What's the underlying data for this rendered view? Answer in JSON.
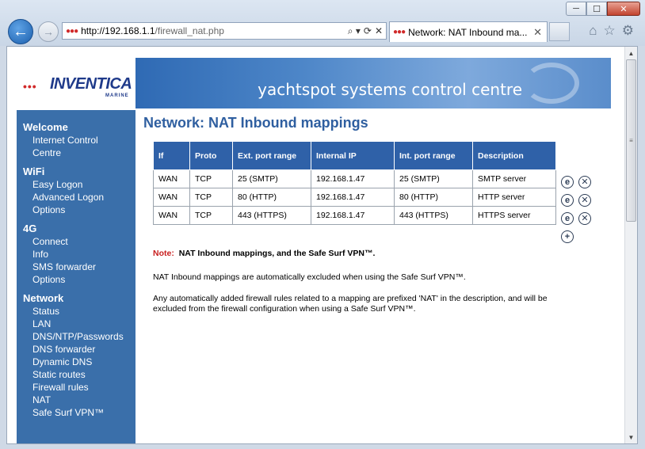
{
  "browser": {
    "url_host": "http://192.168.1.1",
    "url_path": "/firewall_nat.php",
    "tab_title": "Network: NAT Inbound ma...",
    "win_min": "─",
    "win_max": "☐",
    "win_close": "✕",
    "back_glyph": "←",
    "fwd_glyph": "→",
    "addr_icons": [
      "⌕ ▾",
      "⟳",
      "✕"
    ],
    "tab_close": "✕",
    "tool_icons": [
      "⌂",
      "☆",
      "⚙"
    ]
  },
  "header": {
    "logo_word": "INVENTICA",
    "logo_sub": "MARINE",
    "banner_text": "yachtspot systems control centre"
  },
  "sidebar": {
    "sections": [
      {
        "title": "Welcome",
        "items": [
          "Internet Control",
          "Centre"
        ]
      },
      {
        "title": "WiFi",
        "items": [
          "Easy Logon",
          "Advanced Logon",
          "Options"
        ]
      },
      {
        "title": "4G",
        "items": [
          "Connect",
          "Info",
          "SMS forwarder",
          "Options"
        ]
      },
      {
        "title": "Network",
        "items": [
          "Status",
          "LAN",
          "DNS/NTP/Passwords",
          "DNS forwarder",
          "Dynamic DNS",
          "Static routes",
          "Firewall rules",
          "NAT",
          "Safe Surf VPN™"
        ]
      }
    ]
  },
  "main": {
    "title": "Network: NAT Inbound mappings",
    "table": {
      "headers": [
        "If",
        "Proto",
        "Ext. port range",
        "Internal IP",
        "Int. port range",
        "Description"
      ],
      "rows": [
        [
          "WAN",
          "TCP",
          "25 (SMTP)",
          "192.168.1.47",
          "25 (SMTP)",
          "SMTP server"
        ],
        [
          "WAN",
          "TCP",
          "80 (HTTP)",
          "192.168.1.47",
          "80 (HTTP)",
          "HTTP server"
        ],
        [
          "WAN",
          "TCP",
          "443 (HTTPS)",
          "192.168.1.47",
          "443 (HTTPS)",
          "HTTPS server"
        ]
      ]
    },
    "actions": {
      "edit": "e",
      "delete": "✕",
      "add": "+"
    },
    "note_label": "Note:",
    "note_title": "NAT Inbound mappings, and the Safe Surf VPN™.",
    "para1": "NAT Inbound mappings are automatically excluded when using the Safe Surf VPN™.",
    "para2": "Any automatically added firewall rules related to a mapping are prefixed 'NAT' in the description, and will be excluded from the firewall configuration when using a Safe Surf VPN™."
  }
}
